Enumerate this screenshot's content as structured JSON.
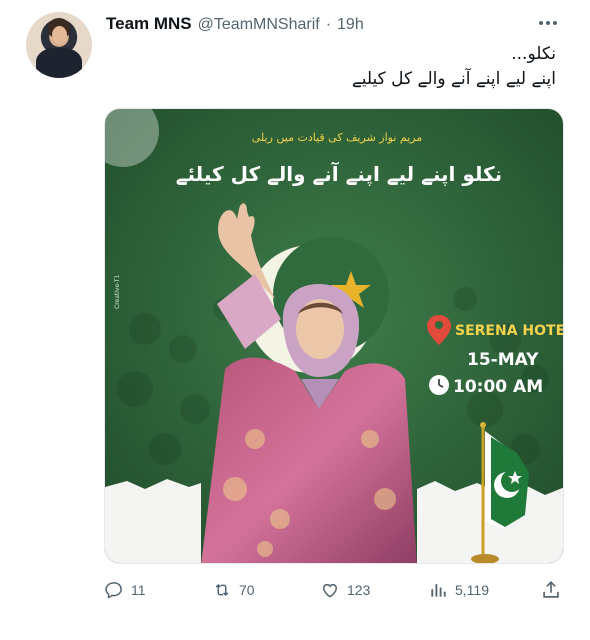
{
  "tweet": {
    "display_name": "Team MNS",
    "handle": "@TeamMNSharif",
    "separator": "·",
    "time": "19h",
    "text_line1": "نکلو...",
    "text_line2": "اپنے لیے اپنے آنے والے کل کیلیے"
  },
  "poster": {
    "subtitle": "مریم نواز شریف کی قیادت میں ریلی",
    "headline": "نکلو اپنے لیے اپنے آنے والے کل کیلئے",
    "venue": "SERENA HOTEL",
    "date": "15-MAY",
    "time": "10:00 AM",
    "credit": "Creative-T1",
    "venue_icon": "location-pin-icon",
    "time_icon": "clock-icon",
    "colors": {
      "green": "#2f6b3c",
      "dark_green": "#1f4a2a",
      "yellow": "#f5d24b",
      "flag_green": "#1f7a3a"
    }
  },
  "actions": {
    "reply_count": "11",
    "retweet_count": "70",
    "like_count": "123",
    "view_count": "5,119"
  },
  "icons": {
    "reply": "reply-icon",
    "retweet": "retweet-icon",
    "like": "heart-icon",
    "views": "views-bar-chart-icon",
    "share": "share-icon",
    "more": "more-options-icon"
  }
}
